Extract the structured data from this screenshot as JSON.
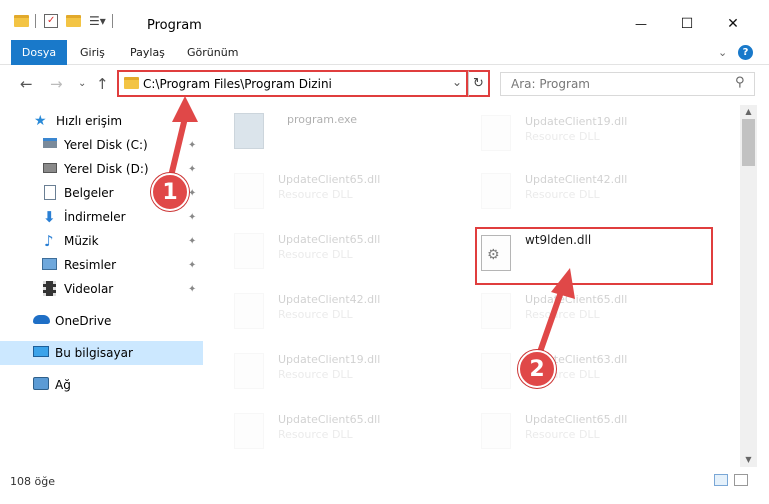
{
  "window": {
    "title": "Program",
    "minimize_icon": "minimize-icon",
    "maximize_icon": "maximize-icon",
    "close_icon": "close-icon",
    "close_glyph": "✕",
    "min_glyph": "—",
    "max_glyph": "☐"
  },
  "ribbon": {
    "tabs": [
      "Dosya",
      "Giriş",
      "Paylaş",
      "Görünüm"
    ],
    "help_glyph": "?",
    "expand_glyph": "⌄"
  },
  "nav": {
    "back_glyph": "←",
    "forward_glyph": "→",
    "recent_glyph": "⌄",
    "up_glyph": "↑"
  },
  "address": {
    "path": "C:\\Program Files\\Program Dizini",
    "dropdown_glyph": "⌄",
    "refresh_glyph": "↻"
  },
  "search": {
    "placeholder": "Ara: Program",
    "icon_glyph": "⚲"
  },
  "sidebar": {
    "quick_access": "Hızlı erişim",
    "items": [
      {
        "label": "Yerel Disk (C:)"
      },
      {
        "label": "Yerel Disk (D:)"
      },
      {
        "label": "Belgeler"
      },
      {
        "label": "İndirmeler"
      },
      {
        "label": "Müzik"
      },
      {
        "label": "Resimler"
      },
      {
        "label": "Videolar"
      }
    ],
    "onedrive": "OneDrive",
    "this_pc": "Bu bilgisayar",
    "network": "Ağ",
    "pin_glyph": "📌"
  },
  "files": {
    "left": [
      {
        "name": "program.exe",
        "type": ""
      },
      {
        "name": "UpdateClient65.dll",
        "type": "Resource DLL"
      },
      {
        "name": "UpdateClient65.dll",
        "type": "Resource DLL"
      },
      {
        "name": "UpdateClient42.dll",
        "type": "Resource DLL"
      },
      {
        "name": "UpdateClient19.dll",
        "type": "Resource DLL"
      },
      {
        "name": "UpdateClient65.dll",
        "type": "Resource DLL"
      }
    ],
    "right": [
      {
        "name": "UpdateClient19.dll",
        "type": "Resource DLL"
      },
      {
        "name": "UpdateClient42.dll",
        "type": "Resource DLL"
      },
      {
        "name": "wt9lden.dll",
        "type": ""
      },
      {
        "name": "UpdateClient65.dll",
        "type": "Resource DLL"
      },
      {
        "name": "UpdateClient63.dll",
        "type": "Resource DLL"
      },
      {
        "name": "UpdateClient65.dll",
        "type": "Resource DLL"
      }
    ]
  },
  "status": {
    "item_count": "108 öğe"
  },
  "annotations": {
    "step1": "1",
    "step2": "2"
  },
  "colors": {
    "accent": "#1979ca",
    "annotation_red": "#e04848",
    "selection": "#cce8ff"
  }
}
